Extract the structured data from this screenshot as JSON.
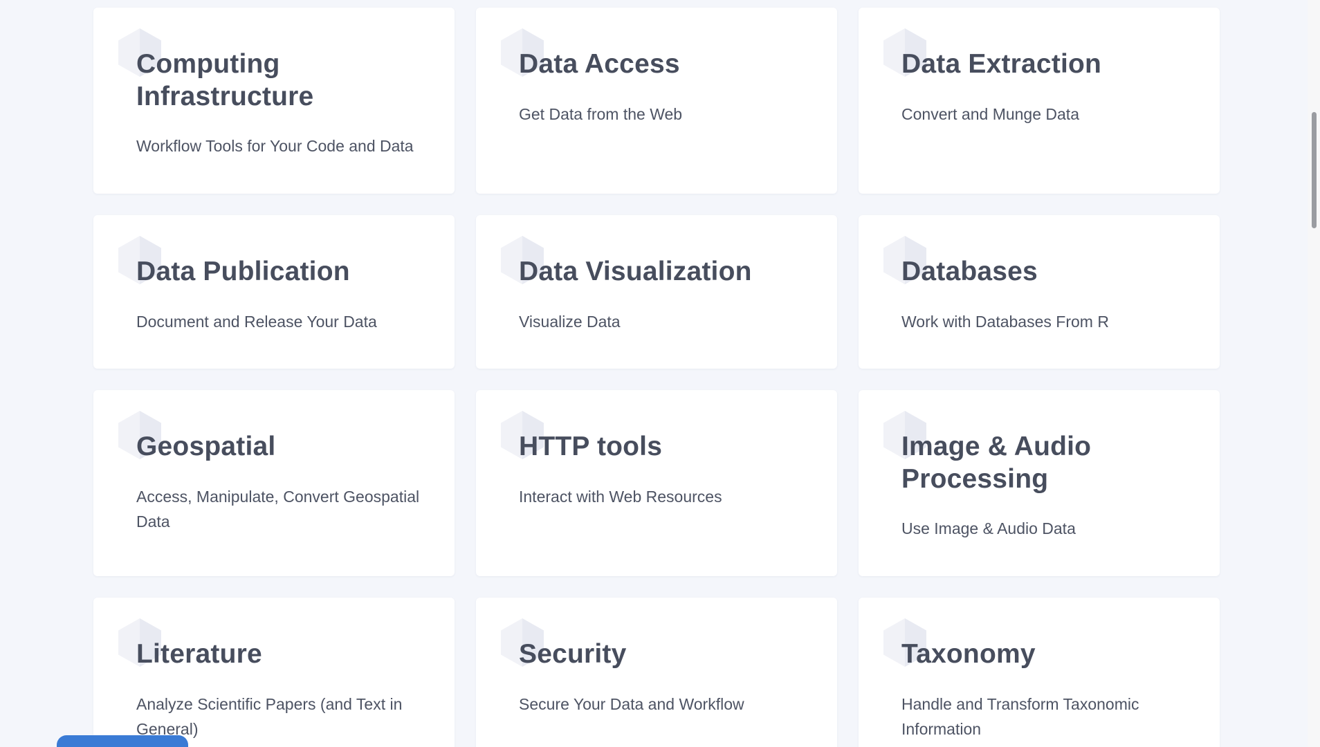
{
  "cards": [
    {
      "title": "Computing Infrastructure",
      "description": "Workflow Tools for Your Code and Data"
    },
    {
      "title": "Data Access",
      "description": "Get Data from the Web"
    },
    {
      "title": "Data Extraction",
      "description": "Convert and Munge Data"
    },
    {
      "title": "Data Publication",
      "description": "Document and Release Your Data"
    },
    {
      "title": "Data Visualization",
      "description": "Visualize Data"
    },
    {
      "title": "Databases",
      "description": "Work with Databases From R"
    },
    {
      "title": "Geospatial",
      "description": "Access, Manipulate, Convert Geospatial Data"
    },
    {
      "title": "HTTP tools",
      "description": "Interact with Web Resources"
    },
    {
      "title": "Image & Audio Processing",
      "description": "Use Image & Audio Data"
    },
    {
      "title": "Literature",
      "description": "Analyze Scientific Papers (and Text in General)"
    },
    {
      "title": "Security",
      "description": "Secure Your Data and Workflow"
    },
    {
      "title": "Taxonomy",
      "description": "Handle and Transform Taxonomic Information"
    }
  ],
  "icons": {
    "card_icon": "hexagon-icon"
  },
  "colors": {
    "background": "#f4f6fb",
    "card": "#ffffff",
    "text": "#474d5d",
    "accent": "#3a7bd5"
  }
}
